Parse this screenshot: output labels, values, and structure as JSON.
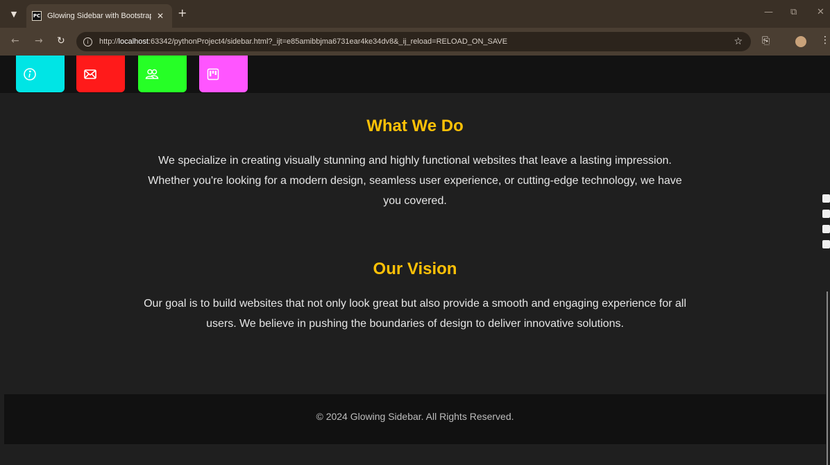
{
  "browser": {
    "tab_title": "Glowing Sidebar with Bootstrap",
    "favicon_label": "PC",
    "url_prefix": "http://",
    "url_host": "localhost",
    "url_rest": ":63342/pythonProject4/sidebar.html?_ijt=e85amibbjma6731ear4ke34dv8&_ij_reload=RELOAD_ON_SAVE"
  },
  "sidebar_buttons": [
    {
      "icon": "info-icon",
      "color": "#00e5e5"
    },
    {
      "icon": "envelope-icon",
      "color": "#ff1a1a"
    },
    {
      "icon": "users-icon",
      "color": "#26ff26"
    },
    {
      "icon": "kanban-icon",
      "color": "#ff55ff"
    }
  ],
  "sections": [
    {
      "title": "What We Do",
      "text": "We specialize in creating visually stunning and highly functional websites that leave a lasting impression. Whether you're looking for a modern design, seamless user experience, or cutting-edge technology, we have you covered."
    },
    {
      "title": "Our Vision",
      "text": "Our goal is to build websites that not only look great but also provide a smooth and engaging experience for all users. We believe in pushing the boundaries of design to deliver innovative solutions."
    }
  ],
  "footer": {
    "text": "© 2024 Glowing Sidebar. All Rights Reserved."
  },
  "colors": {
    "heading": "#ffc107",
    "background": "#1f1f1f",
    "footer_bg": "#111111"
  }
}
